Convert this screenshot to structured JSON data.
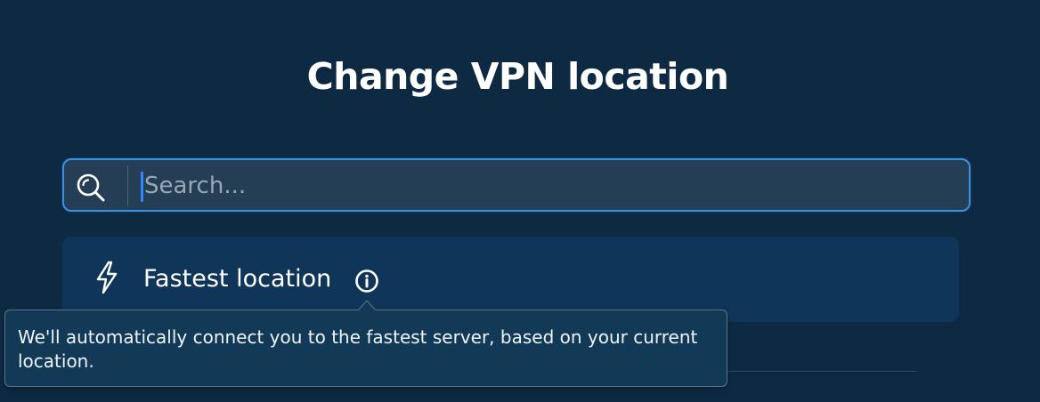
{
  "header": {
    "title": "Change VPN location"
  },
  "search": {
    "placeholder": "Search...",
    "value": ""
  },
  "locations": {
    "fastest": {
      "label": "Fastest location",
      "icon": "lightning-bolt-icon",
      "info_icon": "info-icon"
    }
  },
  "tooltip": {
    "text": "We'll automatically connect you to the fastest server, based on your current location."
  },
  "colors": {
    "background": "#0e2a43",
    "accent": "#3b8fe0",
    "row_highlight": "#0f3659",
    "tooltip_bg": "#123a57"
  }
}
